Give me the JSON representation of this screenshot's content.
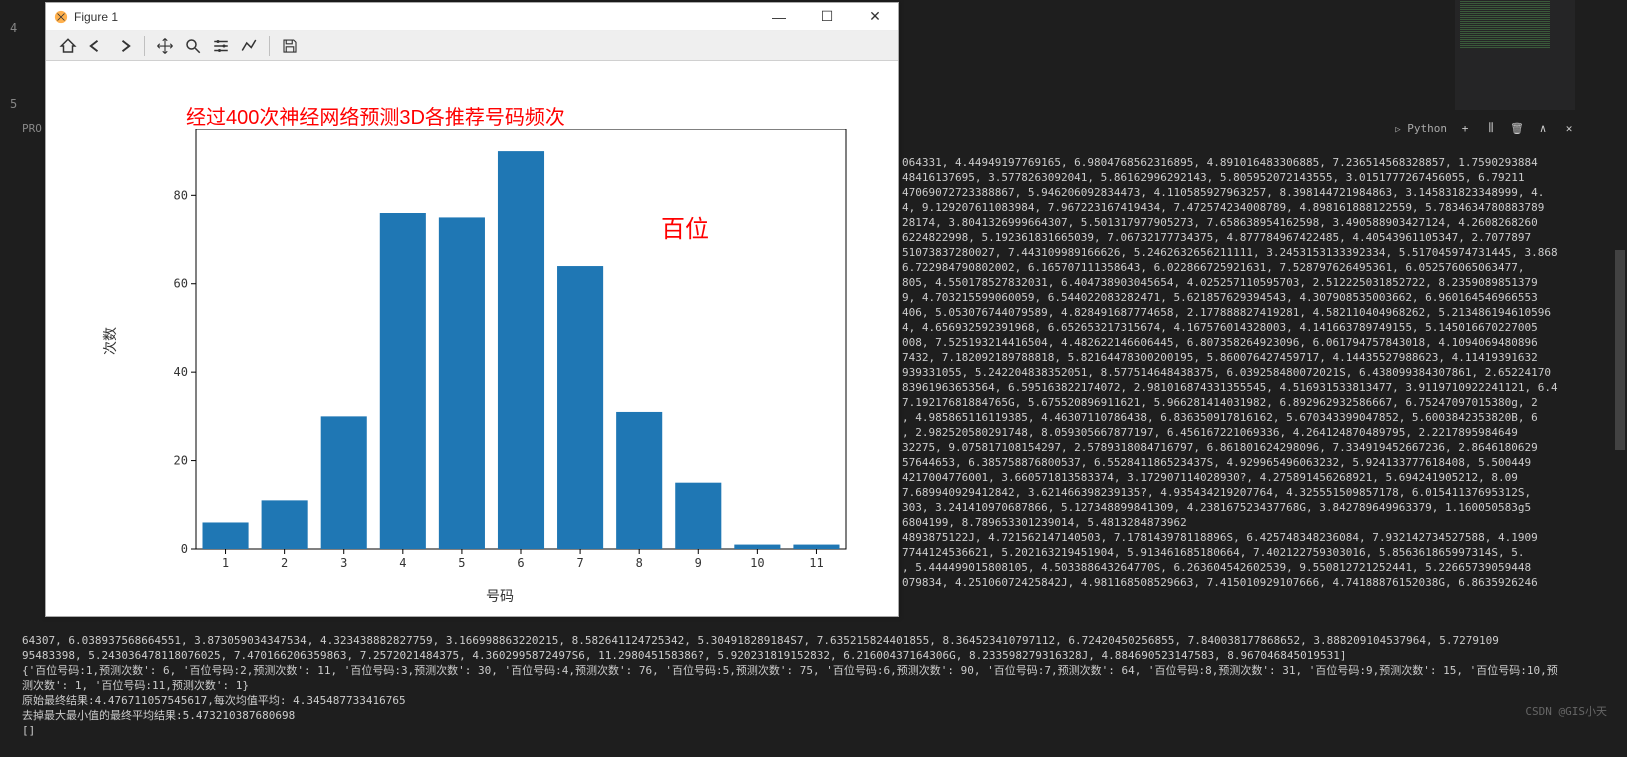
{
  "editor": {
    "line_num_1": "4",
    "line_num_2": "5",
    "panel_label": "PRO"
  },
  "figure": {
    "title": "Figure 1",
    "toolbar": {
      "home": "home-icon",
      "back": "back-icon",
      "forward": "forward-icon",
      "pan": "pan-icon",
      "zoom": "zoom-icon",
      "config": "config-icon",
      "plotline": "plotline-icon",
      "save": "save-icon"
    }
  },
  "chart_data": {
    "type": "bar",
    "title": "经过400次神经网络预测3D各推荐号码频次",
    "annotation": "百位",
    "xlabel": "号码",
    "ylabel": "次数",
    "categories": [
      "1",
      "2",
      "3",
      "4",
      "5",
      "6",
      "7",
      "8",
      "9",
      "10",
      "11"
    ],
    "values": [
      6,
      11,
      30,
      76,
      75,
      90,
      64,
      31,
      15,
      1,
      1
    ],
    "y_ticks": [
      "0",
      "20",
      "40",
      "60",
      "80"
    ],
    "ylim": [
      0,
      95
    ],
    "bar_color": "#1f77b4"
  },
  "terminal": {
    "python_label": "Python",
    "right_frag_1": "064331, 4.44949197769165, 6.9804768562316895, 4.891016483306885, 7.236514568328857, 1.7590293884",
    "right_frag_2": "48416137695, 3.5778263092041, 5.86162996292143, 5.805952072143555, 3.0151777267456055, 6.79211",
    "right_frag_3": "47069072723388867, 5.946206092834473, 4.110585927963257, 8.398144721984863, 3.145831823348999, 4.",
    "right_frag_4": "4, 9.129207611083984, 7.967223167419434, 7.472574234008789, 4.898161888122559, 5.7834634780883789",
    "right_frag_5": "28174, 3.8041326999664307, 5.501317977905273, 7.658638954162598, 3.490588903427124, 4.2608268260",
    "right_frag_6": "6224822998, 5.192361831665039, 7.06732177734375, 4.877784967422485, 4.40543961105347, 2.7077897",
    "right_frag_7": "51073837280027, 7.443109989166626, 5.2462632656211111, 3.2453153133392334, 5.517045974731445, 3.868",
    "right_frag_8": "6.722984790802002, 6.165707111358643, 6.022866725921631, 7.528797626495361, 6.052576065063477,",
    "right_frag_9": "805, 4.550178527832031, 6.404738903045654, 4.025257110595703, 2.512225031852722, 8.2359089851379",
    "right_frag_10": "9, 4.703215599060059, 6.544022083282471, 5.621857629394543, 4.307908535003662, 6.960164546966553",
    "right_frag_11": "406, 5.053076744079589, 4.828491687774658, 2.177888827419281, 4.582110404968262, 5.213486194610596",
    "right_frag_12": "4, 4.656932592391968, 6.652653217315674, 4.167576014328003, 4.141663789749155, 5.145016670227005",
    "right_frag_13": "008, 7.525193214416504, 4.482622146606445, 6.807358264923096, 6.061794757843018, 4.1094069480896",
    "right_frag_14": "7432, 7.182092189788818, 5.82164478300200195, 5.860076427459717, 4.14435527988623, 4.11419391632",
    "right_frag_15": "939331055, 5.242204838352051, 8.577514648438375, 6.039258480072021S, 6.438099384307861, 2.65224170",
    "right_frag_16": "83961963653564, 6.595163822174072, 2.981016874331355545, 4.516931533813477, 3.9119710922241121, 6.4",
    "right_frag_17": "7.19217681884765G, 5.675520896911621, 5.966281414031982, 6.892962932586667, 6.75247097015380g, 2",
    "right_frag_18": ", 4.985865116119385, 4.46307110786438, 6.836350917816162, 5.670343399047852, 5.6003842353820B, 6",
    "right_frag_19": ", 2.982520580291748, 8.059305667877197, 6.456167221069336, 4.264124870489795, 2.2217895984649",
    "right_frag_20": "32275, 9.075817108154297, 2.5789318084716797, 6.861801624298096, 7.334919452667236, 2.8646180629",
    "right_frag_21": "57644653, 6.385758876800537, 6.552841186523437S, 4.929965496063232, 5.924133777618408, 5.500449",
    "right_frag_22": "4217004776001, 3.660571813583374, 3.172907114028930?, 4.275891456268921, 5.694241905212, 8.09",
    "right_frag_23": "7.689940929412842, 3.621466398239135?, 4.935434219207764, 4.325551509857178, 6.01541137695312S,",
    "right_frag_24": "303, 3.241410970687866, 5.127348899841309, 4.238167523437768G, 3.842789649963379, 1.160050583g5",
    "right_frag_25": "6804199, 8.789653301239014, 5.4813284873962",
    "right_frag_26": "4893875122J, 4.721562147140503, 7.178143978118896S, 6.425748348236084, 7.932142734527588, 4.1909",
    "right_frag_27": "7744124536621, 5.202163219451904, 5.913461685180664, 7.402122759303016, 5.856361865997314S, 5.",
    "right_frag_28": ", 5.444499015808105, 4.503388643264770S, 6.263604542602539, 9.550812721252441, 5.22665739059448",
    "right_frag_29": "079834, 4.25106072425842J, 4.981168508529663, 7.415010929107666, 4.74188876152038G, 6.8635926246",
    "bottom_line_1": "64307, 6.038937568664551, 3.873059034347534, 4.323438882827759, 3.166998863220215, 8.582641124725342, 5.304918289184S7, 7.635215824401855, 8.364523410797112, 6.72420450256855, 7.840038177868652, 3.888209104537964, 5.7279109",
    "bottom_line_2": "95483398, 5.243036478118076025, 7.470166206359863, 7.2572021484375, 4.3602995872497S6, 11.298045158386?, 5.920231819152832, 6.21600437164306G, 8.233598279316328J, 4.884690523147583, 8.967046845019531]",
    "dict_line": "{'百位号码:1,预测次数': 6, '百位号码:2,预测次数': 11, '百位号码:3,预测次数': 30, '百位号码:4,预测次数': 76, '百位号码:5,预测次数': 75, '百位号码:6,预测次数': 90, '百位号码:7,预测次数': 64, '百位号码:8,预测次数': 31, '百位号码:9,预测次数': 15, '百位号码:10,预测次数': 1, '百位号码:11,预测次数': 1}",
    "result_1": "原始最终结果:4.476711057545617,每次均值平均: 4.345487733416765",
    "result_2": "去掉最大最小值的最终平均结果:5.473210387680698",
    "result_3": "[]"
  },
  "watermark": "CSDN @GIS小天"
}
